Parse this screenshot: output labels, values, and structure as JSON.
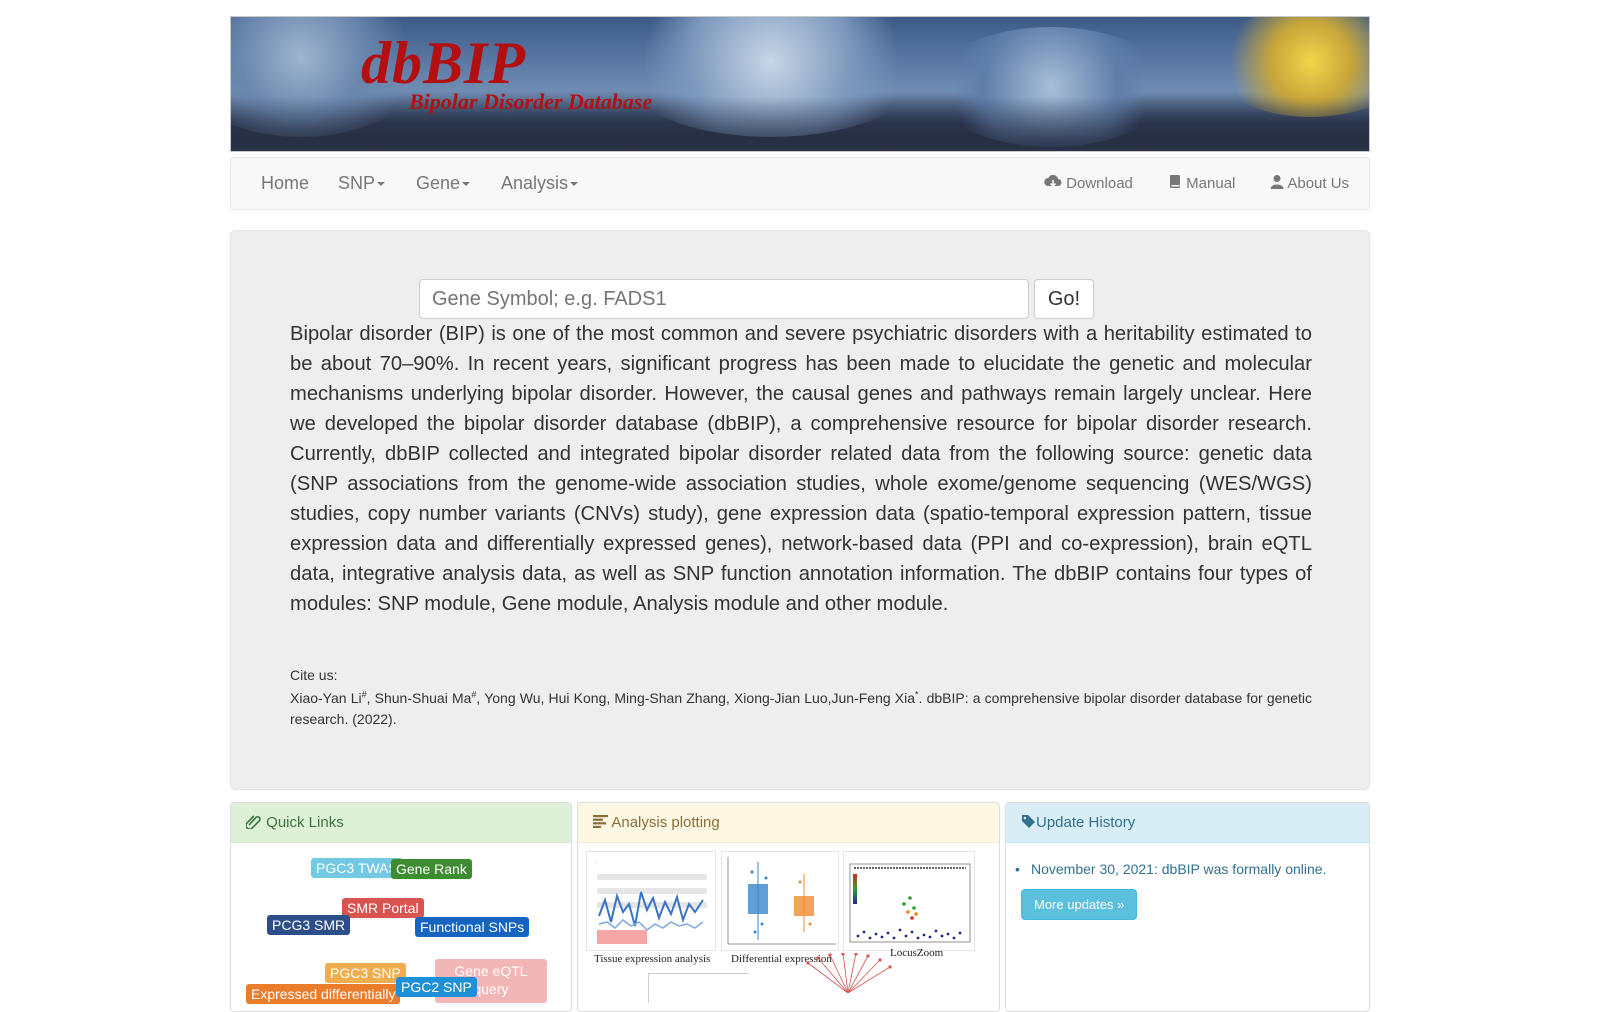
{
  "banner": {
    "title": "dbBIP",
    "subtitle": "Bipolar Disorder Database"
  },
  "nav": {
    "home": "Home",
    "snp": "SNP",
    "gene": "Gene",
    "analysis": "Analysis",
    "download": "Download",
    "manual": "Manual",
    "about": "About Us"
  },
  "search": {
    "placeholder": "Gene Symbol; e.g. FADS1",
    "button": "Go!"
  },
  "intro": "Bipolar disorder (BIP) is one of the most common and severe psychiatric disorders with a heritability estimated to be about 70–90%. In recent years, significant progress has been made to elucidate the genetic and molecular mechanisms underlying bipolar disorder. However, the causal genes and pathways remain largely unclear. Here we developed the bipolar disorder database (dbBIP), a comprehensive resource for bipolar disorder research. Currently, dbBIP collected and integrated bipolar disorder related data from the following source: genetic data (SNP associations from the genome-wide association studies, whole exome/genome sequencing (WES/WGS) studies, copy number variants (CNVs) study), gene expression data (spatio-temporal expression pattern, tissue expression data and differentially expressed genes), network-based data (PPI and co-expression), brain eQTL data, integrative analysis data, as well as SNP function annotation information. The dbBIP contains four types of modules: SNP module, Gene module, Analysis module and other module.",
  "cite": {
    "label": "Cite us:",
    "author1": "Xiao-Yan Li",
    "mark1": "#",
    "author2": ", Shun-Shuai Ma",
    "mark2": "#",
    "authors_rest": ", Yong Wu, Hui Kong, Ming-Shan Zhang, Xiong-Jian Luo,Jun-Feng Xia",
    "mark3": "*",
    "tail": ". dbBIP: a comprehensive bipolar disorder database for genetic research. (2022)."
  },
  "quick_links": {
    "title": "Quick Links",
    "tags": [
      "PGC3 TWAS",
      "Gene Rank",
      "SMR Portal",
      "PCG3 SMR",
      "Functional SNPs",
      "PGC3 SNP",
      "Gene eQTL query",
      "Expressed differentially",
      "PGC2 SNP"
    ]
  },
  "analysis_plotting": {
    "title": "Analysis plotting",
    "captions": [
      "Tissue expression analysis",
      "Differential expression",
      "LocusZoom"
    ]
  },
  "update_history": {
    "title": "Update History",
    "items": [
      "November 30, 2021: dbBIP was formally online."
    ],
    "more": "More updates »"
  }
}
